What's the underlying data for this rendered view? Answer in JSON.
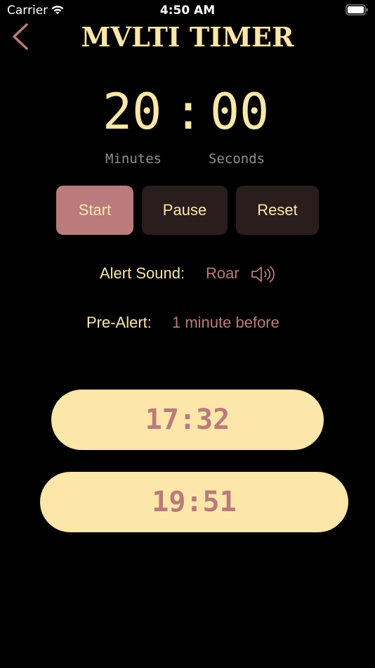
{
  "status_bar": {
    "carrier": "Carrier",
    "time": "4:50 AM"
  },
  "header": {
    "title": "MVLTI TIMER",
    "back_icon": "chevron-left-icon"
  },
  "timer": {
    "minutes": "20",
    "colon": ":",
    "seconds": "00",
    "minutes_label": "Minutes",
    "seconds_label": "Seconds"
  },
  "controls": {
    "start_label": "Start",
    "pause_label": "Pause",
    "reset_label": "Reset"
  },
  "settings": {
    "alert_sound_label": "Alert Sound:",
    "alert_sound_value": "Roar",
    "alert_sound_icon": "speaker-icon",
    "pre_alert_label": "Pre-Alert:",
    "pre_alert_value": "1 minute before"
  },
  "timers": [
    {
      "time": "17:32"
    },
    {
      "time": "19:51"
    }
  ],
  "colors": {
    "background": "#000000",
    "primary_text": "#FCE6A9",
    "accent": "#B97B7B",
    "button_dark": "#2A1D1D",
    "muted": "#8E8E93"
  }
}
